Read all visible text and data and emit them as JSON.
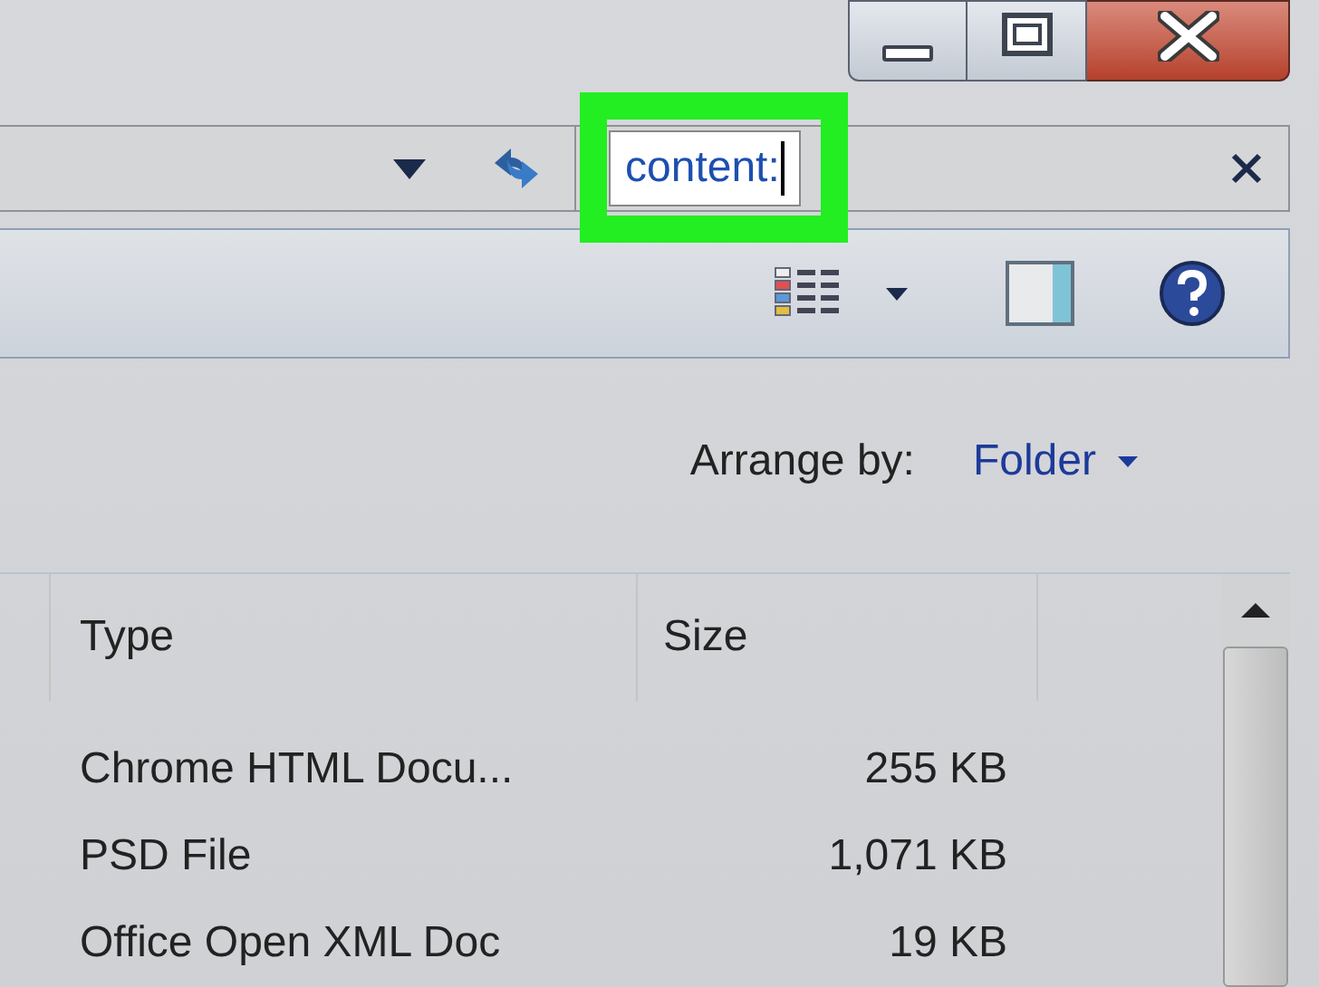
{
  "window_controls": [
    {
      "kind": "minimize"
    },
    {
      "kind": "maximize"
    },
    {
      "kind": "close"
    }
  ],
  "search": {
    "value": "content:",
    "highlighted": true
  },
  "arrange": {
    "label": "Arrange by:",
    "value": "Folder"
  },
  "table": {
    "columns": [
      "Type",
      "Size"
    ],
    "rows": [
      {
        "type": "Chrome HTML Docu...",
        "size": "255 KB"
      },
      {
        "type": "PSD File",
        "size": "1,071 KB"
      },
      {
        "type": "Office Open XML Doc",
        "size": "19 KB"
      }
    ]
  }
}
